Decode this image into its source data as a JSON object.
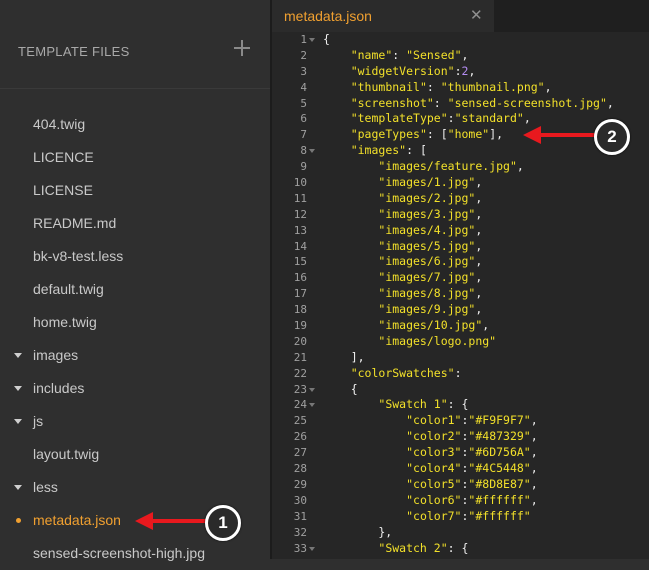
{
  "sidebar": {
    "header": "TEMPLATE FILES",
    "add_icon": "plus-icon",
    "items": [
      {
        "label": "404.twig",
        "type": "file"
      },
      {
        "label": "LICENCE",
        "type": "file"
      },
      {
        "label": "LICENSE",
        "type": "file"
      },
      {
        "label": "README.md",
        "type": "file"
      },
      {
        "label": "bk-v8-test.less",
        "type": "file"
      },
      {
        "label": "default.twig",
        "type": "file"
      },
      {
        "label": "home.twig",
        "type": "file"
      },
      {
        "label": "images",
        "type": "folder"
      },
      {
        "label": "includes",
        "type": "folder"
      },
      {
        "label": "js",
        "type": "folder"
      },
      {
        "label": "layout.twig",
        "type": "file"
      },
      {
        "label": "less",
        "type": "folder"
      },
      {
        "label": "metadata.json",
        "type": "file",
        "active": true
      },
      {
        "label": "sensed-screenshot-high.jpg",
        "type": "file"
      }
    ]
  },
  "editor": {
    "tab_label": "metadata.json",
    "close_icon": "close-icon",
    "lines": [
      {
        "n": "1",
        "fold": true,
        "html": "<span class='p'>{</span>"
      },
      {
        "n": "2",
        "html": "    <span class='k'>\"name\"</span>: <span class='s'>\"Sensed\"</span>,"
      },
      {
        "n": "3",
        "html": "    <span class='k'>\"widgetVersion\"</span>:<span class='n'>2</span>,"
      },
      {
        "n": "4",
        "html": "    <span class='k'>\"thumbnail\"</span>: <span class='s'>\"thumbnail.png\"</span>,"
      },
      {
        "n": "5",
        "html": "    <span class='k'>\"screenshot\"</span>: <span class='s'>\"sensed-screenshot.jpg\"</span>,"
      },
      {
        "n": "6",
        "html": "    <span class='k'>\"templateType\"</span>:<span class='s'>\"standard\"</span>,"
      },
      {
        "n": "7",
        "html": "    <span class='k'>\"pageTypes\"</span>: [<span class='s'>\"home\"</span>],"
      },
      {
        "n": "8",
        "fold": true,
        "html": "    <span class='k'>\"images\"</span>: ["
      },
      {
        "n": "9",
        "html": "        <span class='s'>\"images/feature.jpg\"</span>,"
      },
      {
        "n": "10",
        "html": "        <span class='s'>\"images/1.jpg\"</span>,"
      },
      {
        "n": "11",
        "html": "        <span class='s'>\"images/2.jpg\"</span>,"
      },
      {
        "n": "12",
        "html": "        <span class='s'>\"images/3.jpg\"</span>,"
      },
      {
        "n": "13",
        "html": "        <span class='s'>\"images/4.jpg\"</span>,"
      },
      {
        "n": "14",
        "html": "        <span class='s'>\"images/5.jpg\"</span>,"
      },
      {
        "n": "15",
        "html": "        <span class='s'>\"images/6.jpg\"</span>,"
      },
      {
        "n": "16",
        "html": "        <span class='s'>\"images/7.jpg\"</span>,"
      },
      {
        "n": "17",
        "html": "        <span class='s'>\"images/8.jpg\"</span>,"
      },
      {
        "n": "18",
        "html": "        <span class='s'>\"images/9.jpg\"</span>,"
      },
      {
        "n": "19",
        "html": "        <span class='s'>\"images/10.jpg\"</span>,"
      },
      {
        "n": "20",
        "html": "        <span class='s'>\"images/logo.png\"</span>"
      },
      {
        "n": "21",
        "html": "    ],"
      },
      {
        "n": "22",
        "html": "    <span class='k'>\"colorSwatches\"</span>:"
      },
      {
        "n": "23",
        "fold": true,
        "html": "    {"
      },
      {
        "n": "24",
        "fold": true,
        "html": "        <span class='k'>\"Swatch 1\"</span>: {"
      },
      {
        "n": "25",
        "html": "            <span class='k'>\"color1\"</span>:<span class='s'>\"#F9F9F7\"</span>,"
      },
      {
        "n": "26",
        "html": "            <span class='k'>\"color2\"</span>:<span class='s'>\"#487329\"</span>,"
      },
      {
        "n": "27",
        "html": "            <span class='k'>\"color3\"</span>:<span class='s'>\"#6D756A\"</span>,"
      },
      {
        "n": "28",
        "html": "            <span class='k'>\"color4\"</span>:<span class='s'>\"#4C5448\"</span>,"
      },
      {
        "n": "29",
        "html": "            <span class='k'>\"color5\"</span>:<span class='s'>\"#8D8E87\"</span>,"
      },
      {
        "n": "30",
        "html": "            <span class='k'>\"color6\"</span>:<span class='s'>\"#ffffff\"</span>,"
      },
      {
        "n": "31",
        "html": "            <span class='k'>\"color7\"</span>:<span class='s'>\"#ffffff\"</span>"
      },
      {
        "n": "32",
        "html": "        },"
      },
      {
        "n": "33",
        "fold": true,
        "html": "        <span class='k'>\"Swatch 2\"</span>: {"
      }
    ]
  },
  "callouts": [
    {
      "number": "1"
    },
    {
      "number": "2"
    }
  ],
  "colors": {
    "accent": "#f0a030",
    "arrow": "#e8191e",
    "key": "#f2e02a",
    "number": "#b48cf2"
  }
}
